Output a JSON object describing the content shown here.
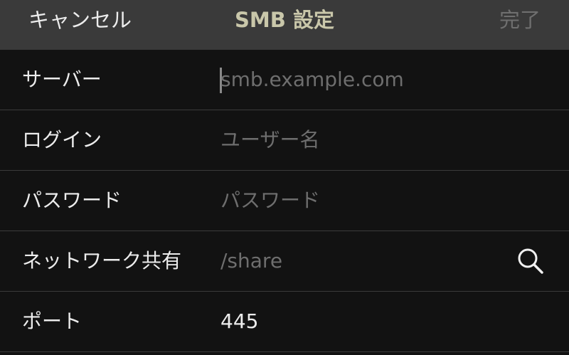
{
  "navbar": {
    "cancel_label": "キャンセル",
    "title": "SMB 設定",
    "done_label": "完了"
  },
  "form": {
    "server": {
      "label": "サーバー",
      "placeholder": "smb.example.com",
      "value": ""
    },
    "login": {
      "label": "ログイン",
      "placeholder": "ユーザー名",
      "value": ""
    },
    "password": {
      "label": "パスワード",
      "placeholder": "パスワード",
      "value": ""
    },
    "share": {
      "label": "ネットワーク共有",
      "placeholder": "/share",
      "value": "",
      "action_icon": "search-icon"
    },
    "port": {
      "label": "ポート",
      "value": "445"
    }
  },
  "colors": {
    "navbar_bg": "#3a3a3a",
    "background": "#121212",
    "title": "#c9c7aa",
    "placeholder": "#6e6e6e",
    "text": "#ececec",
    "disabled": "#6f6f6f"
  }
}
